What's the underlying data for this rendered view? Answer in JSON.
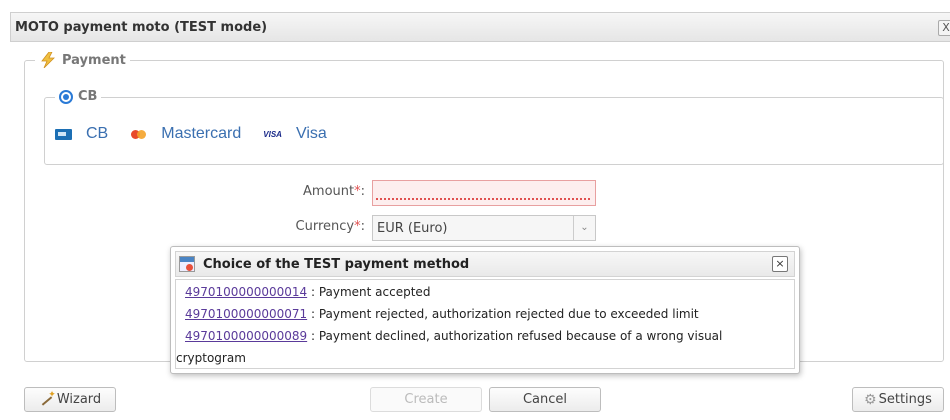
{
  "window": {
    "title": "MOTO payment moto (TEST mode)",
    "close_glyph": "X"
  },
  "payment_section": {
    "legend": "Payment",
    "icon": "lightning-icon"
  },
  "cb_group": {
    "legend": "CB",
    "selected": true,
    "cards": [
      {
        "icon": "cb-card-icon",
        "label": "CB"
      },
      {
        "icon": "mastercard-icon",
        "label": "Mastercard"
      },
      {
        "icon": "visa-icon",
        "label": "Visa",
        "icon_text": "VISA"
      }
    ]
  },
  "form": {
    "amount_label": "Amount",
    "currency_label": "Currency",
    "required_marker": "*",
    "colon": ":",
    "amount_value": "",
    "currency_value": "EUR (Euro)"
  },
  "popup": {
    "title": "Choice of the TEST payment method",
    "close_glyph": "×",
    "options": [
      {
        "card": "4970100000000014",
        "description": " : Payment accepted"
      },
      {
        "card": "4970100000000071",
        "description": " : Payment rejected, authorization rejected due to exceeded limit"
      },
      {
        "card": "4970100000000089",
        "description": " : Payment declined, authorization refused because of a wrong visual"
      }
    ],
    "overflow_text": "cryptogram"
  },
  "buttons": {
    "wizard": "Wizard",
    "create": "Create",
    "cancel": "Cancel",
    "settings": "Settings"
  },
  "colors": {
    "accent": "#2a7ad6",
    "link": "#5a3a9a",
    "card_label": "#3a6fb0",
    "error_border": "#e8a0a0"
  }
}
